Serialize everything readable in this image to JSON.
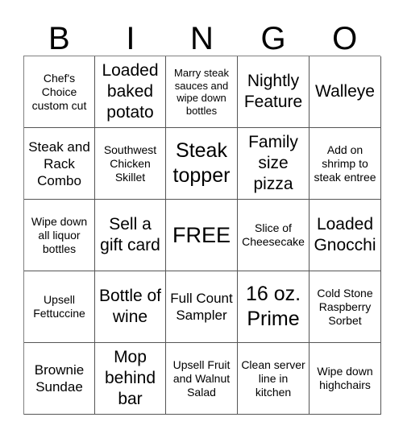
{
  "card": {
    "title": "BINGO",
    "header_letters": [
      "B",
      "I",
      "N",
      "G",
      "O"
    ],
    "columns": 5,
    "rows": 5,
    "free_space_label": "FREE",
    "free_space_position": {
      "row": 3,
      "column": 3
    },
    "colors": {
      "background": "#ffffff",
      "text": "#000000",
      "grid_line": "#555555",
      "grid_outer_line": "#808080"
    },
    "grid": [
      [
        {
          "text": "Chef's Choice custom cut",
          "size": "sm"
        },
        {
          "text": "Loaded baked potato",
          "size": "lg"
        },
        {
          "text": "Marry steak sauces and wipe down bottles",
          "size": "xs"
        },
        {
          "text": "Nightly Feature",
          "size": "lg"
        },
        {
          "text": "Walleye",
          "size": "lg"
        }
      ],
      [
        {
          "text": "Steak and Rack Combo",
          "size": "md"
        },
        {
          "text": "Southwest Chicken Skillet",
          "size": "sm"
        },
        {
          "text": "Steak topper",
          "size": "xl"
        },
        {
          "text": "Family size pizza",
          "size": "lg"
        },
        {
          "text": "Add on shrimp to steak entree",
          "size": "sm"
        }
      ],
      [
        {
          "text": "Wipe down all liquor bottles",
          "size": "sm"
        },
        {
          "text": "Sell a gift card",
          "size": "lg"
        },
        {
          "text": "FREE",
          "size": "free"
        },
        {
          "text": "Slice of Cheesecake",
          "size": "sm"
        },
        {
          "text": "Loaded Gnocchi",
          "size": "lg"
        }
      ],
      [
        {
          "text": "Upsell Fettuccine",
          "size": "sm"
        },
        {
          "text": "Bottle of wine",
          "size": "lg"
        },
        {
          "text": "Full Count Sampler",
          "size": "md"
        },
        {
          "text": "16 oz. Prime",
          "size": "xl"
        },
        {
          "text": "Cold Stone Raspberry Sorbet",
          "size": "sm"
        }
      ],
      [
        {
          "text": "Brownie Sundae",
          "size": "md"
        },
        {
          "text": "Mop behind bar",
          "size": "lg"
        },
        {
          "text": "Upsell Fruit and Walnut Salad",
          "size": "sm"
        },
        {
          "text": "Clean server line in kitchen",
          "size": "sm"
        },
        {
          "text": "Wipe down highchairs",
          "size": "sm"
        }
      ]
    ]
  }
}
